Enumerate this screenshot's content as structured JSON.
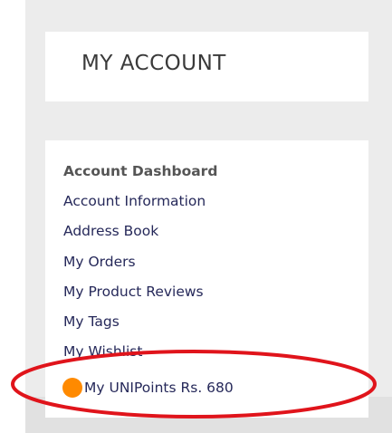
{
  "account_card": {
    "title": "MY ACCOUNT"
  },
  "nav": {
    "items": [
      {
        "label": "Account Dashboard",
        "active": true
      },
      {
        "label": "Account Information"
      },
      {
        "label": "Address Book"
      },
      {
        "label": "My Orders"
      },
      {
        "label": "My Product Reviews"
      },
      {
        "label": "My Tags"
      },
      {
        "label": "My Wishlist"
      }
    ],
    "points": {
      "label": "My UNIPoints Rs. 680",
      "dot_color": "#ff8a00"
    }
  },
  "highlight": {
    "color": "#e0141b"
  }
}
